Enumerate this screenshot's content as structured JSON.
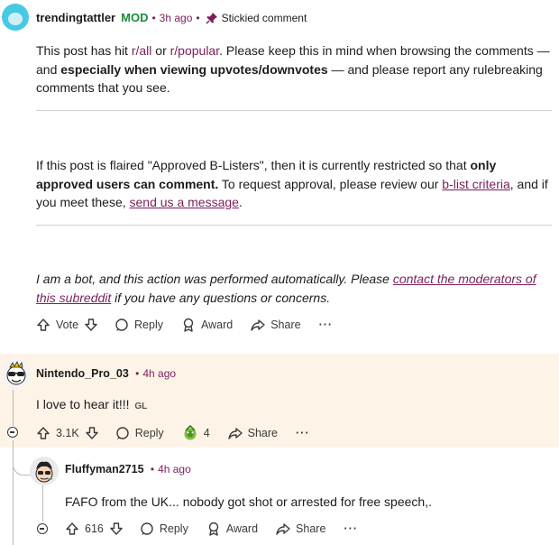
{
  "top_comment": {
    "author": "trendingtattler",
    "mod_badge": "MOD",
    "time": "3h ago",
    "sticky_label": "Stickied comment",
    "p1": {
      "t1": "This post has hit ",
      "link1": "r/all",
      "t2": " or ",
      "link2": "r/popular",
      "t3": ". Please keep this in mind when browsing the comments — and ",
      "bold": "especially when viewing upvotes/downvotes",
      "t4": " — and please report any rulebreaking comments that you see."
    },
    "p2": {
      "t1": "If this post is flaired \"Approved B-Listers\", then it is currently restricted so that ",
      "bold": "only approved users can comment.",
      "t2": " To request approval, please review our ",
      "link1": "b-list criteria",
      "t3": ", and if you meet these, ",
      "link2": "send us a message",
      "t4": "."
    },
    "p3": {
      "t1": "I am a bot, and this action was performed automatically. Please ",
      "link": "contact the moderators of this subreddit",
      "t2": " if you have any questions or concerns."
    },
    "actions": {
      "vote_label": "Vote",
      "reply_label": "Reply",
      "award_label": "Award",
      "share_label": "Share",
      "more_label": "···"
    }
  },
  "comment2": {
    "author": "Nintendo_Pro_03",
    "time": "4h ago",
    "text": "I love to hear it!!!",
    "flair": "GL",
    "actions": {
      "vote_count": "3.1K",
      "reply_label": "Reply",
      "award_count": "4",
      "share_label": "Share",
      "more_label": "···"
    }
  },
  "comment3": {
    "author": "Fluffyman2715",
    "time": "4h ago",
    "text": "FAFO from the UK... nobody got shot or arrested for free speech,.",
    "actions": {
      "vote_count": "616",
      "reply_label": "Reply",
      "award_label": "Award",
      "share_label": "Share",
      "more_label": "···"
    }
  },
  "colors": {
    "accent": "#7a1f5c",
    "mod": "#1a8c3c",
    "highlight_bg": "#fdf3e7",
    "avatar_top": "#47c9e4"
  }
}
